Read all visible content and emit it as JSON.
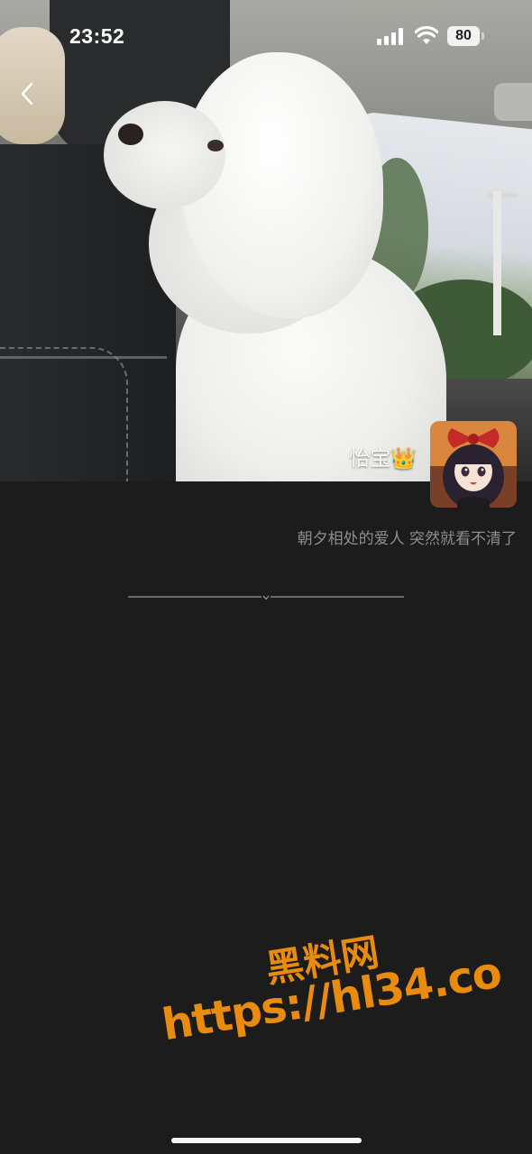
{
  "status_bar": {
    "time": "23:52",
    "battery": "80",
    "icons": [
      "cellular-signal-icon",
      "wifi-icon",
      "battery-icon"
    ]
  },
  "header": {
    "back_icon": "chevron-left-icon"
  },
  "profile": {
    "cover_photo": "white poodle dog sitting in car",
    "nickname": "怡宝👑",
    "avatar": "anime girl with red bow",
    "signature": "朝夕相处的爱人 突然就看不清了"
  },
  "watermark": {
    "name": "黑料网",
    "url": "https://hl34.co",
    "color": "#e88b0e"
  },
  "colors": {
    "background": "#1c1c1c",
    "signature_text": "#8d8d8d"
  }
}
